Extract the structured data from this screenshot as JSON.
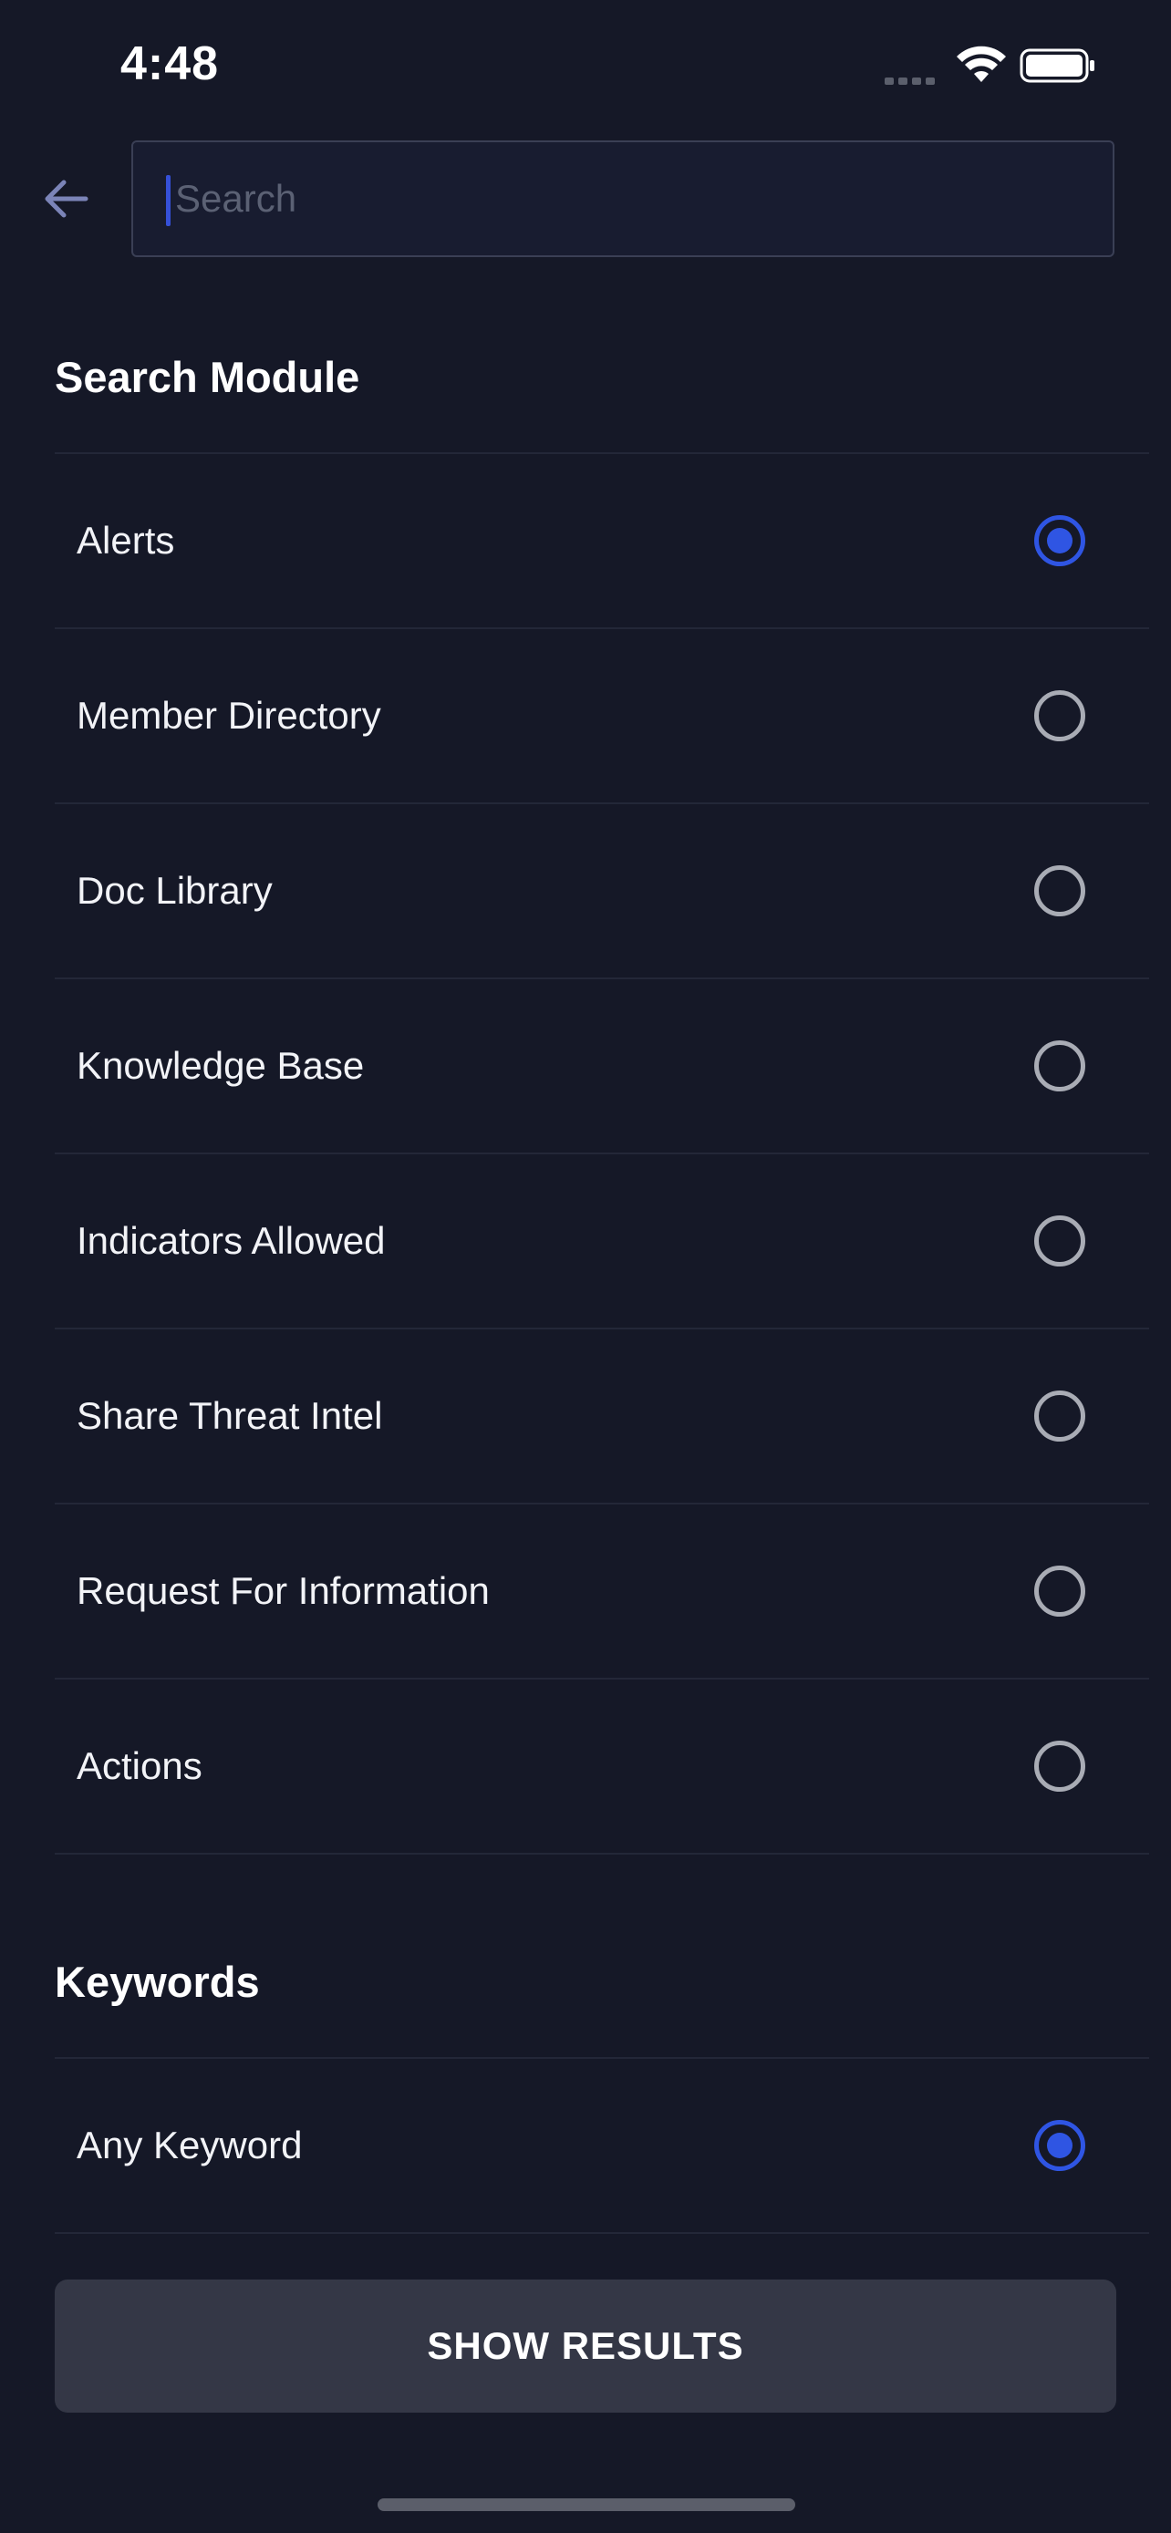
{
  "status_bar": {
    "time": "4:48"
  },
  "search": {
    "placeholder": "Search",
    "value": ""
  },
  "search_module": {
    "title": "Search Module",
    "options": [
      {
        "label": "Alerts",
        "selected": true
      },
      {
        "label": "Member Directory",
        "selected": false
      },
      {
        "label": "Doc Library",
        "selected": false
      },
      {
        "label": "Knowledge Base",
        "selected": false
      },
      {
        "label": "Indicators Allowed",
        "selected": false
      },
      {
        "label": "Share Threat Intel",
        "selected": false
      },
      {
        "label": "Request For Information",
        "selected": false
      },
      {
        "label": "Actions",
        "selected": false
      }
    ]
  },
  "keywords": {
    "title": "Keywords",
    "options": [
      {
        "label": "Any Keyword",
        "selected": true
      }
    ]
  },
  "actions": {
    "show_results_label": "SHOW RESULTS"
  },
  "colors": {
    "background": "#151827",
    "accent": "#2f55e3",
    "button": "#343746",
    "divider": "#232738"
  }
}
